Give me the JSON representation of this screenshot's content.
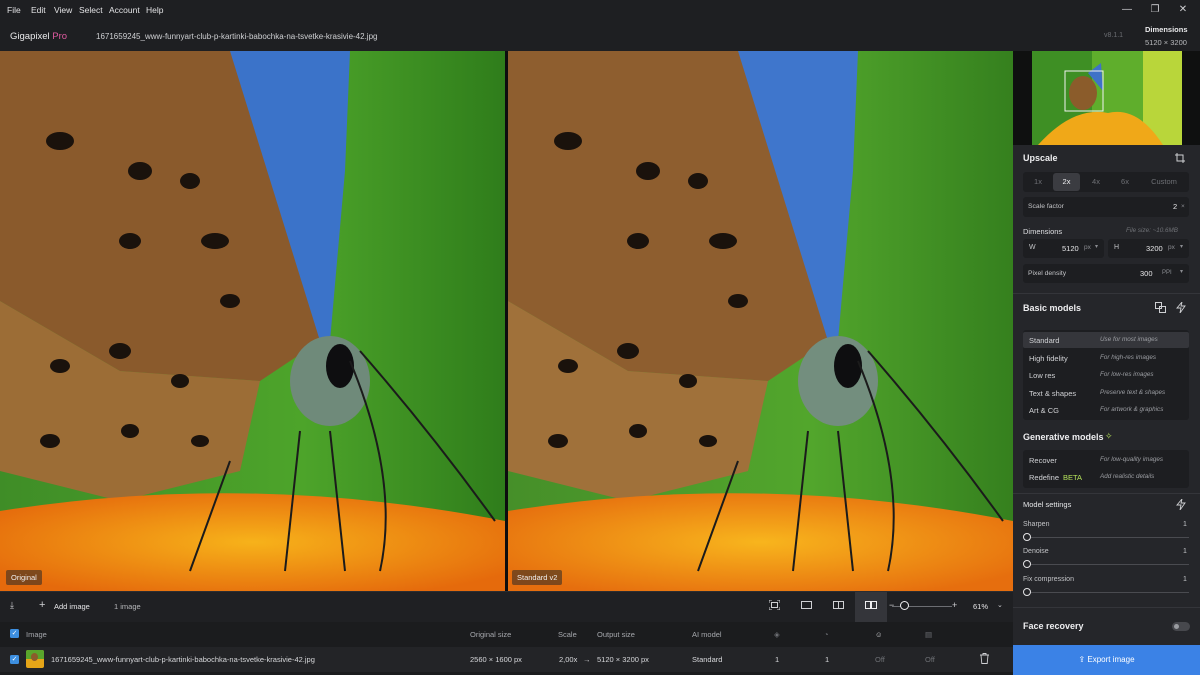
{
  "menu": [
    "File",
    "Edit",
    "View",
    "Select",
    "Account",
    "Help"
  ],
  "window_controls": {
    "minimize": "—",
    "restore": "❐",
    "close": "✕"
  },
  "app": {
    "name": "Gigapixel",
    "edition": "Pro",
    "version": "v8.1.1"
  },
  "file_name": "1671659245_www-funnyart-club-p-kartinki-babochka-na-tsvetke-krasivie-42.jpg",
  "dimensions_header": {
    "title": "Dimensions",
    "value": "5120 × 3200"
  },
  "preview": {
    "left_label": "Original",
    "right_label": "Standard v2"
  },
  "upscale": {
    "title": "Upscale",
    "factors": [
      "1x",
      "2x",
      "4x",
      "6x",
      "Custom"
    ],
    "active_factor": "2x",
    "scale_factor_label": "Scale factor",
    "scale_factor_value": "2",
    "scale_factor_unit": "×"
  },
  "dimensions": {
    "title": "Dimensions",
    "file_size": "File size: ~10.6MB",
    "w_label": "W",
    "w_value": "5120",
    "w_unit": "px",
    "h_label": "H",
    "h_value": "3200",
    "h_unit": "px",
    "density_label": "Pixel density",
    "density_value": "300",
    "density_unit": "PPI"
  },
  "basic_models": {
    "title": "Basic models",
    "items": [
      {
        "label": "Standard",
        "desc": "Use for most images"
      },
      {
        "label": "High fidelity",
        "desc": "For high-res images"
      },
      {
        "label": "Low res",
        "desc": "For low-res images"
      },
      {
        "label": "Text & shapes",
        "desc": "Preserve text & shapes"
      },
      {
        "label": "Art & CG",
        "desc": "For artwork & graphics"
      }
    ]
  },
  "generative_models": {
    "title": "Generative models",
    "items": [
      {
        "label": "Recover",
        "desc": "For low-quality images"
      },
      {
        "label": "Redefine",
        "badge": "BETA",
        "desc": "Add realistic details"
      }
    ]
  },
  "model_settings": {
    "title": "Model settings",
    "sliders": [
      {
        "label": "Sharpen",
        "value": "1"
      },
      {
        "label": "Denoise",
        "value": "1"
      },
      {
        "label": "Fix compression",
        "value": "1"
      }
    ]
  },
  "face_recovery": {
    "title": "Face recovery",
    "enabled": false
  },
  "export_label": "Export image",
  "toolbar": {
    "add_image": "Add image",
    "count": "1 image",
    "zoom": "61%"
  },
  "table": {
    "headers": [
      "Image",
      "Original size",
      "Scale",
      "Output size",
      "AI model"
    ],
    "row": {
      "name": "1671659245_www-funnyart-club-p-kartinki-babochka-na-tsvetke-krasivie-42.jpg",
      "original_size": "2560 × 1600 px",
      "scale": "2,00x",
      "arrow": "→",
      "output_size": "5120 × 3200 px",
      "model": "Standard",
      "col1": "1",
      "col2": "1",
      "col3": "Off",
      "col4": "Off"
    }
  },
  "colors": {
    "accent": "#3b82e6",
    "pro": "#e05aa0",
    "beta": "#b5e35a"
  }
}
